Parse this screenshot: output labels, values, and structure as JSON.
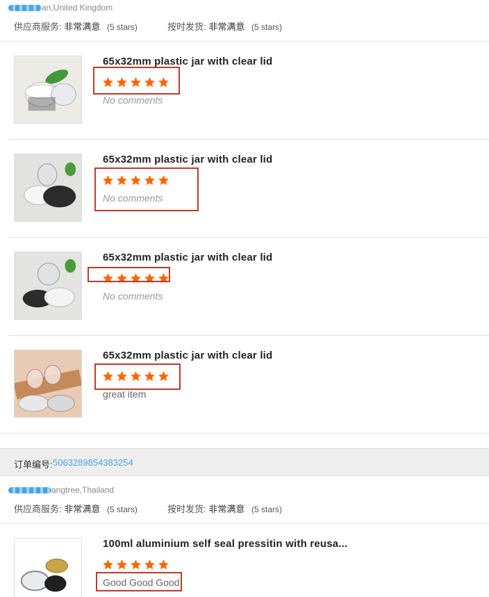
{
  "review_blocks": [
    {
      "reviewer_location": "an,United Kingdom",
      "ratings": {
        "supplier_service_label": "供应商服务:",
        "supplier_service_value": "非常满意",
        "supplier_service_stars": "(5 stars)",
        "on_time_label": "按时发货:",
        "on_time_value": "非常满意",
        "on_time_stars": "(5 stars)"
      },
      "items": [
        {
          "title": "65x32mm plastic jar with clear lid",
          "rating": 5,
          "comment": "No comments",
          "thumb_icon": "plastic-jar-leaf-image"
        },
        {
          "title": "65x32mm plastic jar with clear lid",
          "rating": 5,
          "comment": "No comments",
          "thumb_icon": "jar-lids-image"
        },
        {
          "title": "65x32mm plastic jar with clear lid",
          "rating": 5,
          "comment": "No comments",
          "thumb_icon": "jar-lids-image"
        },
        {
          "title": "65x32mm plastic jar with clear lid",
          "rating": 5,
          "comment": "great item",
          "thumb_icon": "jar-wood-tray-image"
        }
      ]
    },
    {
      "order_label": "订单编号:",
      "order_number": "5063289854383254",
      "reviewer_location": "angtree,Thailand",
      "ratings": {
        "supplier_service_label": "供应商服务:",
        "supplier_service_value": "非常满意",
        "supplier_service_stars": "(5 stars)",
        "on_time_label": "按时发货:",
        "on_time_value": "非常满意",
        "on_time_stars": "(5 stars)"
      },
      "items": [
        {
          "title": "100ml aluminium self seal pressitin with reusa...",
          "rating": 5,
          "comment": "Good Good Good",
          "thumb_icon": "tin-can-image"
        }
      ]
    }
  ],
  "colors": {
    "star": "#ff6600",
    "annotation": "#c0392b",
    "link": "#4aa3e8"
  }
}
